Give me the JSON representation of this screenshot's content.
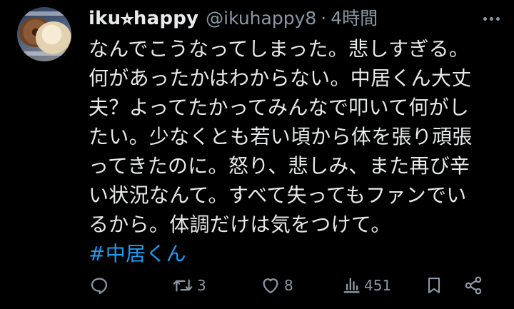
{
  "tweet": {
    "display_name": "iku⭐︎happy",
    "handle": "@ikuhappy8",
    "separator": "·",
    "time": "4時間",
    "body_lines": [
      "なんでこうなってしまった。悲しすぎる。",
      "何があったかはわからない。中居くん大丈",
      "夫？よってたかってみんなで叩いて何がし",
      "たい。少なくとも若い頃から体を張り頑張",
      "ってきたのに。怒り、悲しみ、また再び辛",
      "い状況なんて。すべて失ってもファンでい",
      "るから。体調だけは気をつけて。"
    ],
    "hashtag": "#中居くん"
  },
  "actions": {
    "reply": {
      "icon": "reply-icon"
    },
    "retweet": {
      "icon": "retweet-icon",
      "count": "3"
    },
    "like": {
      "icon": "heart-icon",
      "count": "8"
    },
    "views": {
      "icon": "views-icon",
      "count": "451"
    },
    "bookmark": {
      "icon": "bookmark-icon"
    },
    "share": {
      "icon": "share-icon"
    }
  },
  "colors": {
    "background": "#000000",
    "text": "#e7e9ea",
    "muted": "#8b98a5",
    "link": "#1d9bf0"
  }
}
